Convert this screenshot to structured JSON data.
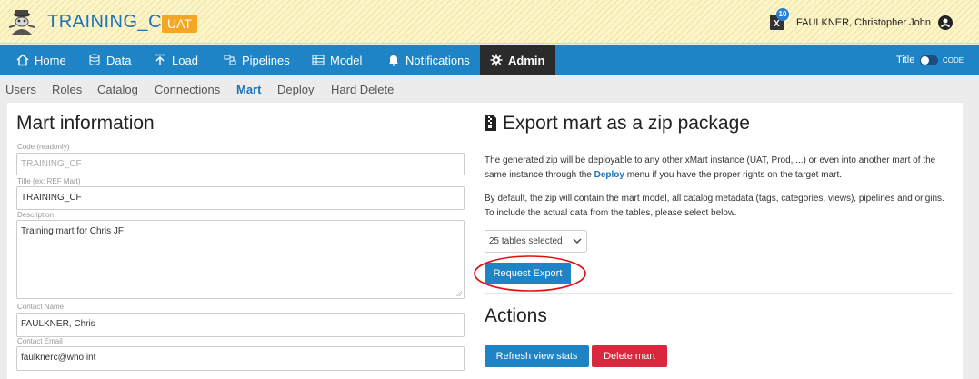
{
  "header": {
    "app_title": "TRAINING_CF",
    "env_badge": "UAT",
    "notification_count": "10",
    "user_name": "FAULKNER, Christopher John"
  },
  "nav": {
    "items": [
      {
        "label": "Home",
        "icon": "home-icon"
      },
      {
        "label": "Data",
        "icon": "database-icon"
      },
      {
        "label": "Load",
        "icon": "upload-icon"
      },
      {
        "label": "Pipelines",
        "icon": "pipelines-icon"
      },
      {
        "label": "Model",
        "icon": "table-icon"
      },
      {
        "label": "Notifications",
        "icon": "bell-icon"
      },
      {
        "label": "Admin",
        "icon": "gear-icon",
        "active": true
      }
    ],
    "toggle_title": "Title",
    "toggle_code": "CODE"
  },
  "subnav": {
    "items": [
      "Users",
      "Roles",
      "Catalog",
      "Connections",
      "Mart",
      "Deploy",
      "Hard Delete"
    ],
    "active": "Mart"
  },
  "mart_info": {
    "heading": "Mart information",
    "code_label": "Code (readonly)",
    "code_value": "TRAINING_CF",
    "title_label": "Title (ex: REF Mart)",
    "title_value": "TRAINING_CF",
    "description_label": "Description",
    "description_value": "Training mart for Chris JF",
    "contact_name_label": "Contact Name",
    "contact_name_value": "FAULKNER, Chris",
    "contact_email_label": "Contact Email",
    "contact_email_value": "faulknerc@who.int"
  },
  "export": {
    "heading": "Export mart as a zip package",
    "para1_before": "The generated zip will be deployable to any other xMart instance (UAT, Prod, ...) or even into another mart of the same instance through the ",
    "para1_link": "Deploy",
    "para1_after": " menu if you have the proper rights on the target mart.",
    "para2": "By default, the zip will contain the mart model, all catalog metadata (tags, categories, views), pipelines and origins. To include the actual data from the tables, please select below.",
    "select_value": "25 tables selected",
    "request_button": "Request Export"
  },
  "actions": {
    "heading": "Actions",
    "refresh_button": "Refresh view stats",
    "delete_button": "Delete mart"
  },
  "colors": {
    "nav_bg": "#1e84c6",
    "active_nav_bg": "#2b2b2b",
    "env_badge": "#f5a623",
    "danger": "#d9283e",
    "annotation": "#e01010"
  }
}
